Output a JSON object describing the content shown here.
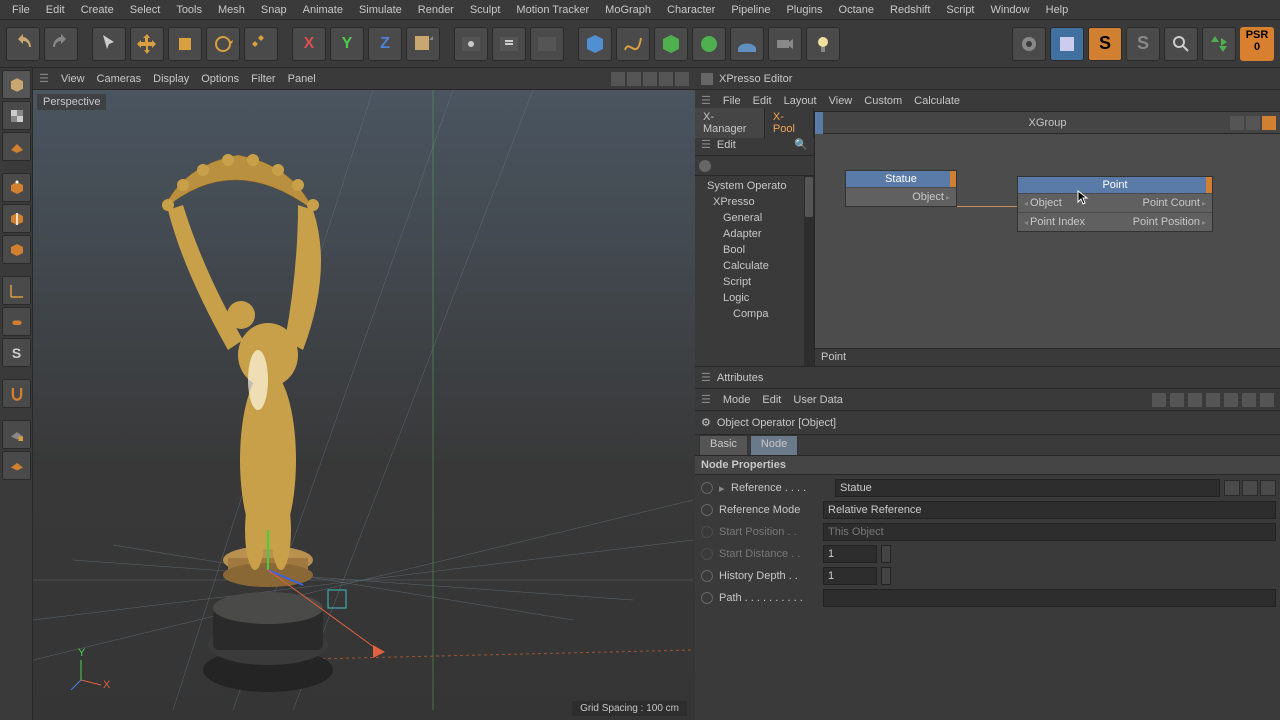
{
  "menu": [
    "File",
    "Edit",
    "Create",
    "Select",
    "Tools",
    "Mesh",
    "Snap",
    "Animate",
    "Simulate",
    "Render",
    "Sculpt",
    "Motion Tracker",
    "MoGraph",
    "Character",
    "Pipeline",
    "Plugins",
    "Octane",
    "Redshift",
    "Script",
    "Window",
    "Help"
  ],
  "viewport_menu": [
    "View",
    "Cameras",
    "Display",
    "Options",
    "Filter",
    "Panel"
  ],
  "viewport_label": "Perspective",
  "grid_info": "Grid Spacing : 100 cm",
  "xpresso": {
    "title": "XPresso Editor",
    "menu": [
      "File",
      "Edit",
      "Layout",
      "View",
      "Custom",
      "Calculate"
    ],
    "tabs": {
      "manager": "X-Manager",
      "pool": "X-Pool"
    },
    "edit_label": "Edit",
    "xgroup_title": "XGroup",
    "status": "Point",
    "tree": [
      {
        "label": "System Operato",
        "level": 0
      },
      {
        "label": "XPresso",
        "level": 1
      },
      {
        "label": "General",
        "level": 2
      },
      {
        "label": "Adapter",
        "level": 2
      },
      {
        "label": "Bool",
        "level": 2
      },
      {
        "label": "Calculate",
        "level": 2
      },
      {
        "label": "Script",
        "level": 2
      },
      {
        "label": "Logic",
        "level": 2
      },
      {
        "label": "Compa",
        "level": 3
      }
    ],
    "node1": {
      "title": "Statue",
      "out": "Object"
    },
    "node2": {
      "title": "Point",
      "in1": "Object",
      "in2": "Point Index",
      "out1": "Point Count",
      "out2": "Point Position"
    }
  },
  "attributes": {
    "title": "Attributes",
    "menu": [
      "Mode",
      "Edit",
      "User Data"
    ],
    "object_title": "Object Operator [Object]",
    "tabs": {
      "basic": "Basic",
      "node": "Node"
    },
    "section": "Node Properties",
    "rows": {
      "reference": {
        "label": "Reference . . . .",
        "value": "Statue"
      },
      "refmode": {
        "label": "Reference Mode",
        "value": "Relative Reference"
      },
      "startpos": {
        "label": "Start Position . .",
        "value": "This Object"
      },
      "startdist": {
        "label": "Start Distance . .",
        "value": "1"
      },
      "history": {
        "label": "History Depth . .",
        "value": "1"
      },
      "path": {
        "label": "Path . . . . . . . . . .",
        "value": ""
      }
    }
  },
  "psr": {
    "label": "PSR",
    "count": "0"
  }
}
